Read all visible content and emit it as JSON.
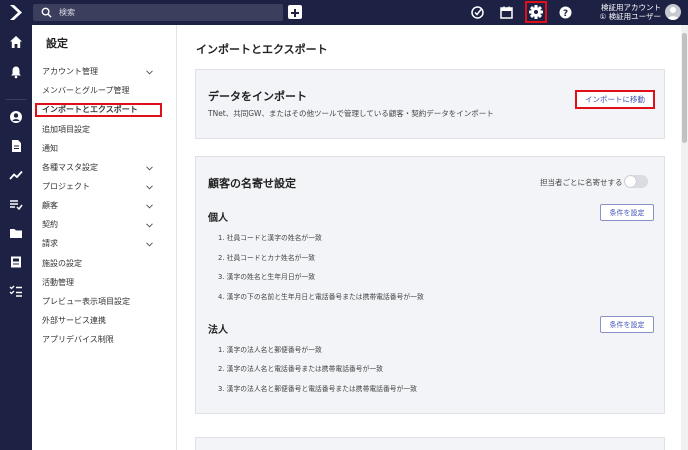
{
  "topbar": {
    "search_placeholder": "検索",
    "account_line1": "検証用アカウント",
    "account_line2": "① 検証用ユーザー",
    "icons": [
      "search-icon",
      "plus-icon",
      "check-circle-icon",
      "calendar-icon",
      "gear-icon",
      "help-icon"
    ]
  },
  "rail": {
    "icons": [
      "home-icon",
      "bell-icon",
      "person-icon",
      "document-icon",
      "trend-icon",
      "list-icon",
      "folder-icon",
      "book-icon",
      "checklist-icon"
    ]
  },
  "menu": {
    "title": "設定",
    "items": [
      {
        "label": "アカウント管理",
        "has_chevron": true
      },
      {
        "label": "メンバーとグループ管理",
        "has_chevron": false
      },
      {
        "label": "インポートとエクスポート",
        "has_chevron": false,
        "active": true
      },
      {
        "label": "追加項目設定",
        "has_chevron": false
      },
      {
        "label": "通知",
        "has_chevron": false
      },
      {
        "label": "各種マスタ設定",
        "has_chevron": true
      },
      {
        "label": "プロジェクト",
        "has_chevron": true
      },
      {
        "label": "顧客",
        "has_chevron": true
      },
      {
        "label": "契約",
        "has_chevron": true
      },
      {
        "label": "請求",
        "has_chevron": true
      },
      {
        "label": "施設の設定",
        "has_chevron": false
      },
      {
        "label": "活動管理",
        "has_chevron": false
      },
      {
        "label": "プレビュー表示項目設定",
        "has_chevron": false
      },
      {
        "label": "外部サービス連携",
        "has_chevron": false
      },
      {
        "label": "アプリデバイス制限",
        "has_chevron": false
      }
    ]
  },
  "main": {
    "title": "インポートとエクスポート",
    "import_card": {
      "title": "データをインポート",
      "description": "TNet、共同GW、またはその他ツールで管理している顧客・契約データをインポート",
      "button": "インポートに移動"
    },
    "merge_card": {
      "title": "顧客の名寄せ設定",
      "toggle_label": "担当者ごとに名寄せする",
      "toggle_on": false,
      "individual": {
        "title": "個人",
        "button": "条件を設定",
        "rules": [
          "1. 社員コードと漢字の姓名が一致",
          "2. 社員コードとカナ姓名が一致",
          "3. 漢字の姓名と生年月日が一致",
          "4. 漢字の下の名前と生年月日と電話番号または携帯電話番号が一致"
        ]
      },
      "corporate": {
        "title": "法人",
        "button": "条件を設定",
        "rules": [
          "1. 漢字の法人名と郵便番号が一致",
          "2. 漢字の法人名と電話番号または携帯電話番号が一致",
          "3. 漢字の法人名と郵便番号と電話番号または携帯電話番号が一致"
        ]
      }
    }
  },
  "colors": {
    "navy": "#1d2143",
    "accent": "#3f51b5",
    "highlight": "#e0101a"
  }
}
